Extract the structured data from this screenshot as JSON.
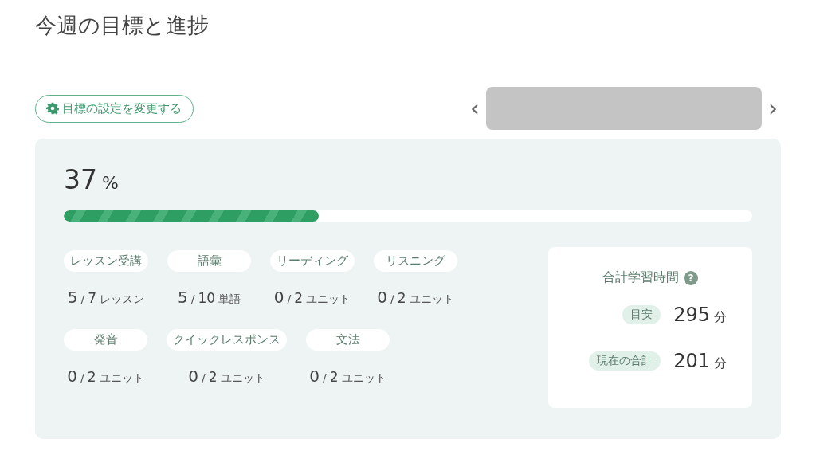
{
  "title": "今週の目標と進捗",
  "settings_button": {
    "label": "目標の設定を変更する"
  },
  "progress": {
    "value": "37",
    "unit": "%",
    "level": 0.37
  },
  "goals": [
    {
      "label": "レッスン受講",
      "done": "5",
      "separator": "/",
      "total": "7",
      "unit": "レッスン"
    },
    {
      "label": "語彙",
      "done": "5",
      "separator": "/",
      "total": "10",
      "unit": "単語"
    },
    {
      "label": "リーディング",
      "done": "0",
      "separator": "/",
      "total": "2",
      "unit": "ユニット"
    },
    {
      "label": "リスニング",
      "done": "0",
      "separator": "/",
      "total": "2",
      "unit": "ユニット"
    },
    {
      "label": "発音",
      "done": "0",
      "separator": "/",
      "total": "2",
      "unit": "ユニット"
    },
    {
      "label": "クイックレスポンス",
      "done": "0",
      "separator": "/",
      "total": "2",
      "unit": "ユニット"
    },
    {
      "label": "文法",
      "done": "0",
      "separator": "/",
      "total": "2",
      "unit": "ユニット"
    }
  ],
  "study_time": {
    "title": "合計学習時間",
    "help": "?",
    "rows": [
      {
        "label": "目安",
        "value": "295",
        "unit": "分"
      },
      {
        "label": "現在の合計",
        "value": "201",
        "unit": "分"
      }
    ]
  },
  "week_nav": {
    "prev": "‹",
    "next": "›"
  }
}
